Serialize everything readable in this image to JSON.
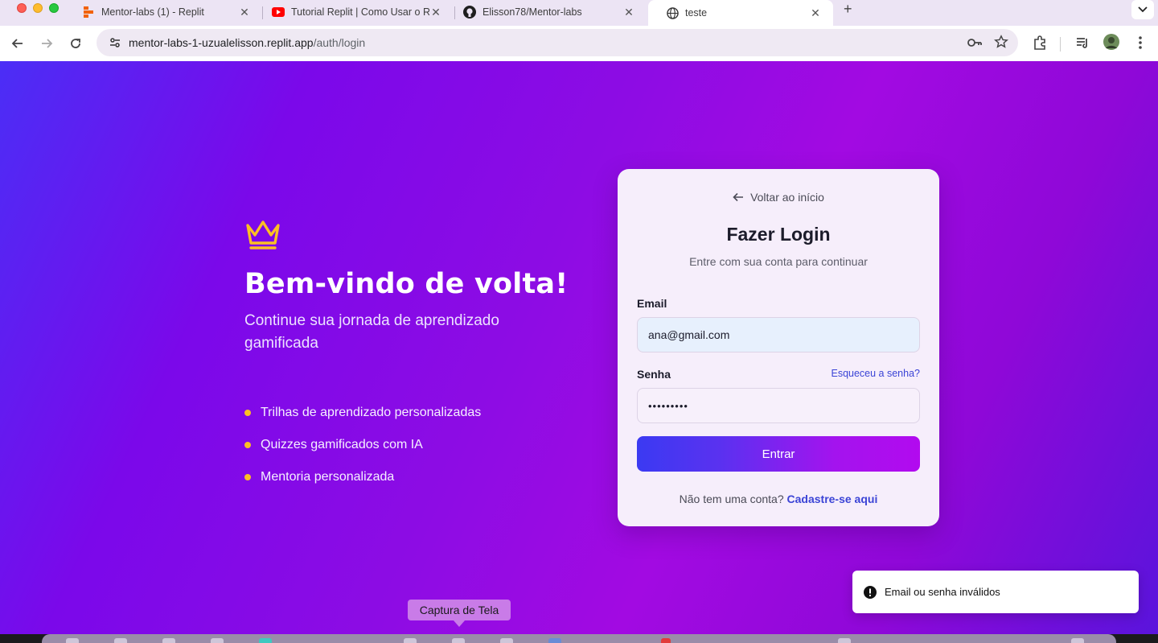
{
  "browser": {
    "tabs": [
      {
        "title": "Mentor-labs (1) - Replit",
        "icon": "replit-icon",
        "active": false
      },
      {
        "title": "Tutorial Replit | Como Usar o R",
        "icon": "youtube-icon",
        "active": false
      },
      {
        "title": "Elisson78/Mentor-labs",
        "icon": "github-icon",
        "active": false
      },
      {
        "title": "teste",
        "icon": "globe-icon",
        "active": true
      }
    ],
    "url_host": "mentor-labs-1-uzualelisson.replit.app",
    "url_path": "/auth/login"
  },
  "welcome": {
    "title": "Bem-vindo de volta!",
    "subtitle": "Continue sua jornada de aprendizado gamificada",
    "features": [
      "Trilhas de aprendizado personalizadas",
      "Quizzes gamificados com IA",
      "Mentoria personalizada"
    ]
  },
  "login": {
    "back_label": "Voltar ao início",
    "title": "Fazer Login",
    "subtitle": "Entre com sua conta para continuar",
    "email_label": "Email",
    "email_value": "ana@gmail.com",
    "password_label": "Senha",
    "forgot_label": "Esqueceu a senha?",
    "password_value": "•••••••••",
    "submit_label": "Entrar",
    "signup_prompt": "Não tem uma conta?",
    "signup_link": "Cadastre-se aqui"
  },
  "toast": {
    "message": "Email ou senha inválidos"
  },
  "tooltip": {
    "text": "Captura de Tela"
  },
  "colors": {
    "accent": "#3b44d6",
    "crown": "#fbbf24",
    "bullet": "#fbbf24"
  }
}
